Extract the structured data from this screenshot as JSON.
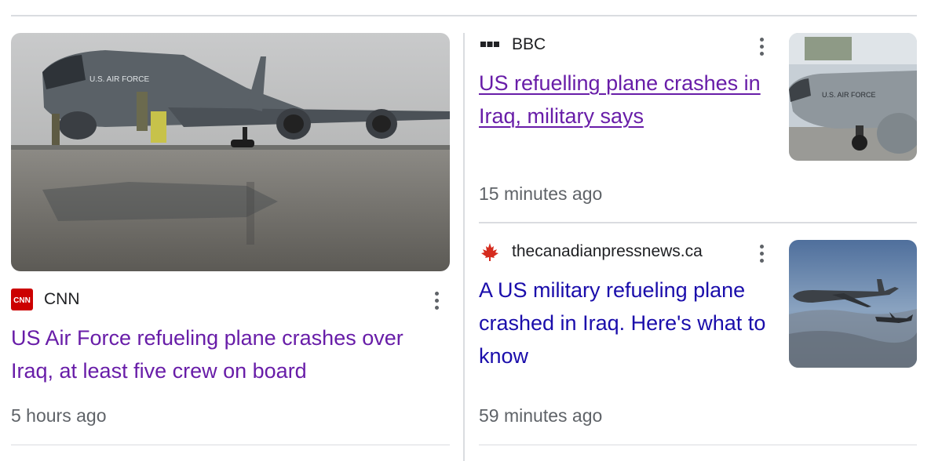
{
  "stories": [
    {
      "source": "CNN",
      "source_logo": "cnn-logo",
      "headline": "US Air Force refueling plane crashes over Iraq, at least five crew on board",
      "time": "5 hours ago",
      "thumbnail_icon": "kc135-on-tarmac-photo"
    },
    {
      "source": "BBC",
      "source_logo": "bbc-logo",
      "headline": "US refuelling plane crashes in Iraq, military says",
      "time": "15 minutes ago",
      "thumbnail_icon": "usaf-tanker-nose-photo"
    },
    {
      "source": "thecanadianpressnews.ca",
      "source_logo": "maple-leaf-logo",
      "headline": "A US military refueling plane crashed in Iraq. Here's what to know",
      "time": "59 minutes ago",
      "thumbnail_icon": "aerial-refueling-photo"
    }
  ],
  "photo_text": {
    "left_fuselage": "U.S. AIR FORCE",
    "right_fuselage": "U.S. AIR FORCE"
  },
  "colors": {
    "visited_link": "#681da8",
    "unvisited_link": "#1a0dab",
    "meta_text": "#5f6368",
    "divider": "#dadce0",
    "cnn_red": "#cc0000",
    "maple_red": "#d52b1e"
  }
}
